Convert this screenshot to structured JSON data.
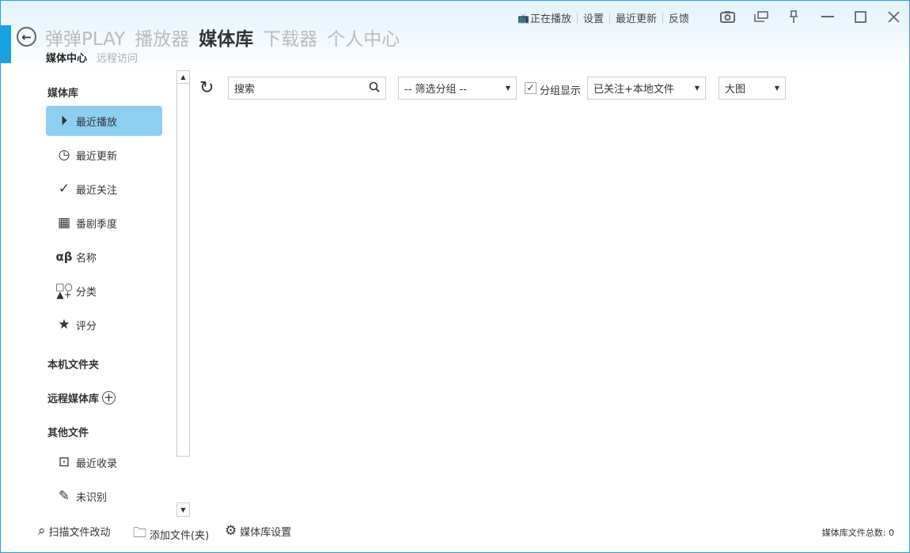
{
  "header": {
    "nav": [
      "弹弹PLAY",
      "播放器",
      "媒体库",
      "下载器",
      "个人中心"
    ],
    "subnav": [
      "媒体中心",
      "远程访问"
    ],
    "toplinks": [
      "正在播放",
      "设置",
      "最近更新",
      "反馈"
    ]
  },
  "sidebar": {
    "section_library": "媒体库",
    "items": [
      {
        "label": "最近播放",
        "icon": "play-circle-icon",
        "active": true
      },
      {
        "label": "最近更新",
        "icon": "clock-refresh-icon"
      },
      {
        "label": "最近关注",
        "icon": "check-plus-icon"
      },
      {
        "label": "番剧季度",
        "icon": "calendar-icon"
      },
      {
        "label": "名称",
        "icon": "alpha-beta-icon"
      },
      {
        "label": "分类",
        "icon": "shapes-icon"
      },
      {
        "label": "评分",
        "icon": "star-half-icon"
      }
    ],
    "section_local": "本机文件夹",
    "section_remote": "远程媒体库",
    "section_other": "其他文件",
    "other_items": [
      {
        "label": "最近收录",
        "icon": "add-box-icon"
      },
      {
        "label": "未识别",
        "icon": "magic-wand-icon"
      }
    ]
  },
  "toolbar": {
    "search_placeholder": "搜索",
    "group_filter": "-- 筛选分组 --",
    "group_display_label": "分组显示",
    "group_display_checked": true,
    "source_filter": "已关注+本地文件",
    "view_mode": "大图"
  },
  "bottom": {
    "scan": "扫描文件改动",
    "add": "添加文件(夹)",
    "settings": "媒体库设置",
    "total": "媒体库文件总数: 0"
  },
  "colors": {
    "accent": "#1ba1e2",
    "active_item": "#8ccff0"
  }
}
